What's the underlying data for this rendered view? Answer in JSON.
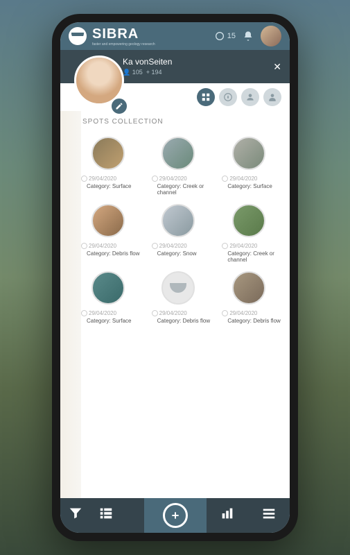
{
  "header": {
    "logo": "SIBRA",
    "tagline": "faster and empowering geology research",
    "notif_count": "15"
  },
  "profile": {
    "name": "Ka vonSeiten",
    "followers": "105",
    "following": "194"
  },
  "section_title": "SPOTS COLLECTION",
  "spots": [
    {
      "date": "29/04/2020",
      "cat": "Category: Surface"
    },
    {
      "date": "29/04/2020",
      "cat": "Category: Creek or channel"
    },
    {
      "date": "29/04/2020",
      "cat": "Category: Surface"
    },
    {
      "date": "29/04/2020",
      "cat": "Category: Debris flow"
    },
    {
      "date": "29/04/2020",
      "cat": "Category: Snow"
    },
    {
      "date": "29/04/2020",
      "cat": "Category: Creek or channel"
    },
    {
      "date": "29/04/2020",
      "cat": "Category: Surface"
    },
    {
      "date": "29/04/2020",
      "cat": "Category: Debris flow"
    },
    {
      "date": "29/04/2020",
      "cat": "Category: Debris flow"
    }
  ]
}
